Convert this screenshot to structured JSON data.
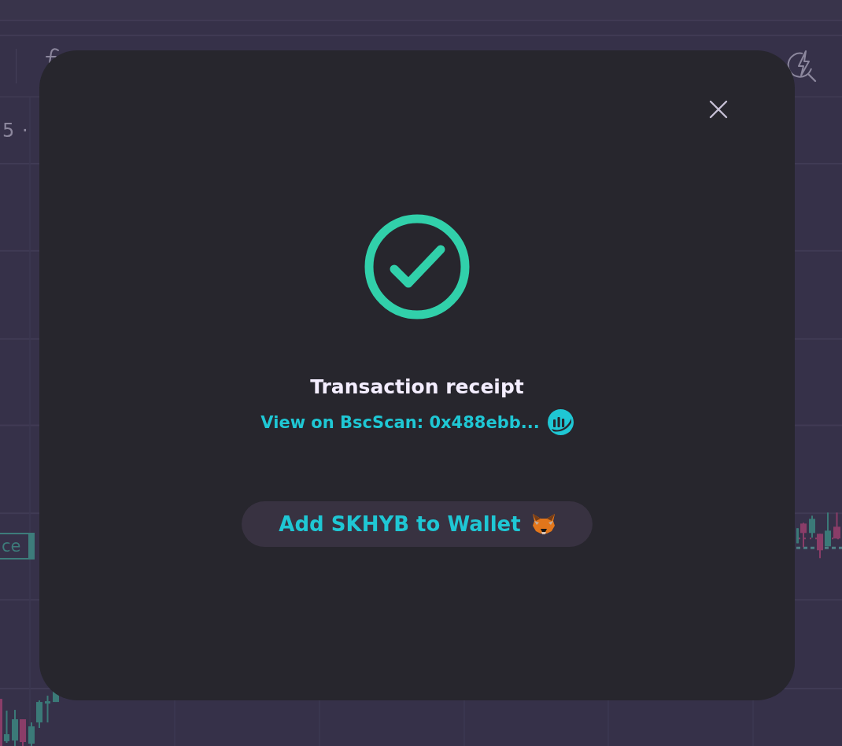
{
  "chart": {
    "legend": "5 ·",
    "price_tag": "ce"
  },
  "dialog": {
    "title": "Transaction receipt",
    "link": "View on BscScan: 0x488ebb...",
    "button": "Add SKHYB to Wallet"
  }
}
